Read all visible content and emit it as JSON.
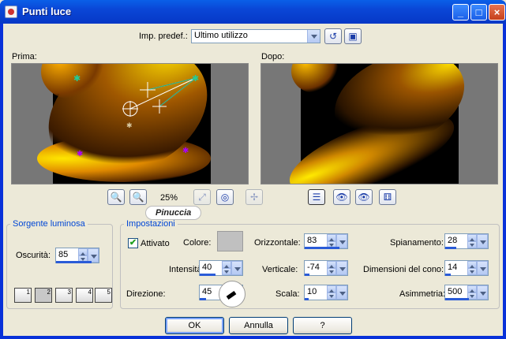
{
  "window": {
    "title": "Punti luce"
  },
  "preset": {
    "label": "Imp. predef.:",
    "value": "Ultimo utilizzo"
  },
  "preview": {
    "before_label": "Prima:",
    "after_label": "Dopo:",
    "zoom": "25%",
    "watermark": "Pinuccia"
  },
  "light_source": {
    "legend": "Sorgente luminosa",
    "darkness_label": "Oscurità:",
    "darkness_value": "85",
    "slots": [
      "1",
      "2",
      "3",
      "4",
      "5"
    ]
  },
  "settings": {
    "legend": "Impostazioni",
    "enabled_label": "Attivato",
    "enabled": true,
    "color_label": "Colore:",
    "color": "#c0c0c0",
    "intensity_label": "Intensità:",
    "intensity": "40",
    "direction_label": "Direzione:",
    "direction": "45",
    "horizontal_label": "Orizzontale:",
    "horizontal": "83",
    "vertical_label": "Verticale:",
    "vertical": "-74",
    "scale_label": "Scala:",
    "scale": "10",
    "flattening_label": "Spianamento:",
    "flattening": "28",
    "cone_label": "Dimensioni del cono:",
    "cone": "14",
    "asymmetry_label": "Asimmetria:",
    "asymmetry": "500"
  },
  "buttons": {
    "ok": "OK",
    "cancel": "Annulla",
    "help": "?"
  }
}
